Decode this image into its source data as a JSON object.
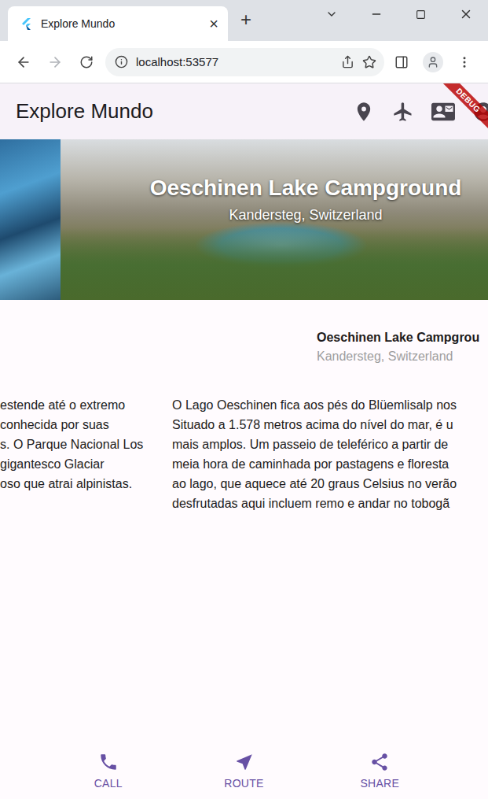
{
  "window": {
    "title": "Explore Mundo",
    "close": "×",
    "new_tab": "+"
  },
  "toolbar": {
    "url": "localhost:53577",
    "back_disabled": false,
    "forward_disabled": true
  },
  "app": {
    "title": "Explore Mundo",
    "debug_banner": "DEBUG"
  },
  "hero": {
    "title": "Oeschinen Lake Campground",
    "subtitle": "Kandersteg, Switzerland"
  },
  "location": {
    "name": "Oeschinen Lake Campgrou",
    "place": "Kandersteg, Switzerland"
  },
  "description_columns": [
    {
      "kind": "left",
      "lines": [
        "estende até o extremo",
        "conhecida por suas",
        "s. O Parque Nacional Los",
        "gigantesco Glaciar",
        "oso que atrai alpinistas."
      ]
    },
    {
      "kind": "right",
      "lines": [
        "O Lago Oeschinen fica aos pés do Blüemlisalp nos",
        "Situado a 1.578 metros acima do nível do mar, é u",
        "mais amplos. Um passeio de teleférico a partir de",
        "meia hora de caminhada por pastagens e floresta",
        "ao lago, que aquece até 20 graus Celsius no verão",
        "desfrutadas aqui incluem remo e andar no tobogã"
      ]
    }
  ],
  "actions": [
    {
      "label": "CALL",
      "icon": "phone"
    },
    {
      "label": "ROUTE",
      "icon": "route"
    },
    {
      "label": "SHARE",
      "icon": "share"
    }
  ]
}
